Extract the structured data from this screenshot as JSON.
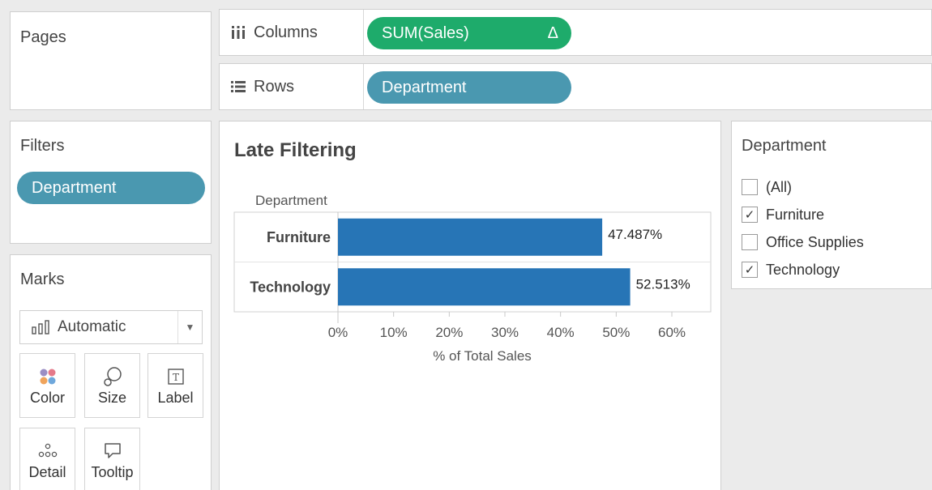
{
  "pages": {
    "title": "Pages"
  },
  "shelves": {
    "columns": {
      "label": "Columns",
      "pill": "SUM(Sales)",
      "pill_delta": "Δ",
      "pill_color": "#1eab6b"
    },
    "rows": {
      "label": "Rows",
      "pill": "Department",
      "pill_color": "#4a98b0"
    }
  },
  "filters": {
    "title": "Filters",
    "pill": "Department",
    "pill_color": "#4a98b0"
  },
  "marks": {
    "title": "Marks",
    "type": "Automatic",
    "buttons": {
      "color": "Color",
      "size": "Size",
      "label": "Label",
      "detail": "Detail",
      "tooltip": "Tooltip"
    },
    "icons": {
      "type": "bar-chart-icon",
      "color": "color-dots-icon",
      "size": "size-bubble-icon",
      "label": "text-t-icon",
      "detail": "detail-dots-icon",
      "tooltip": "speech-bubble-icon"
    }
  },
  "view": {
    "title": "Late Filtering",
    "row_header": "Department"
  },
  "chart_data": {
    "type": "bar",
    "orientation": "horizontal",
    "title": "Late Filtering",
    "categories": [
      "Furniture",
      "Technology"
    ],
    "values": [
      47.487,
      52.513
    ],
    "value_labels": [
      "47.487%",
      "52.513%"
    ],
    "xlabel": "% of Total Sales",
    "ylabel": "Department",
    "xlim": [
      0,
      60
    ],
    "ticks": [
      "0%",
      "10%",
      "20%",
      "30%",
      "40%",
      "50%",
      "60%"
    ],
    "bar_color": "#2775b6",
    "grid": false
  },
  "filter_card": {
    "title": "Department",
    "items": [
      {
        "label": "(All)",
        "checked": false
      },
      {
        "label": "Furniture",
        "checked": true
      },
      {
        "label": "Office Supplies",
        "checked": false
      },
      {
        "label": "Technology",
        "checked": true
      }
    ]
  }
}
